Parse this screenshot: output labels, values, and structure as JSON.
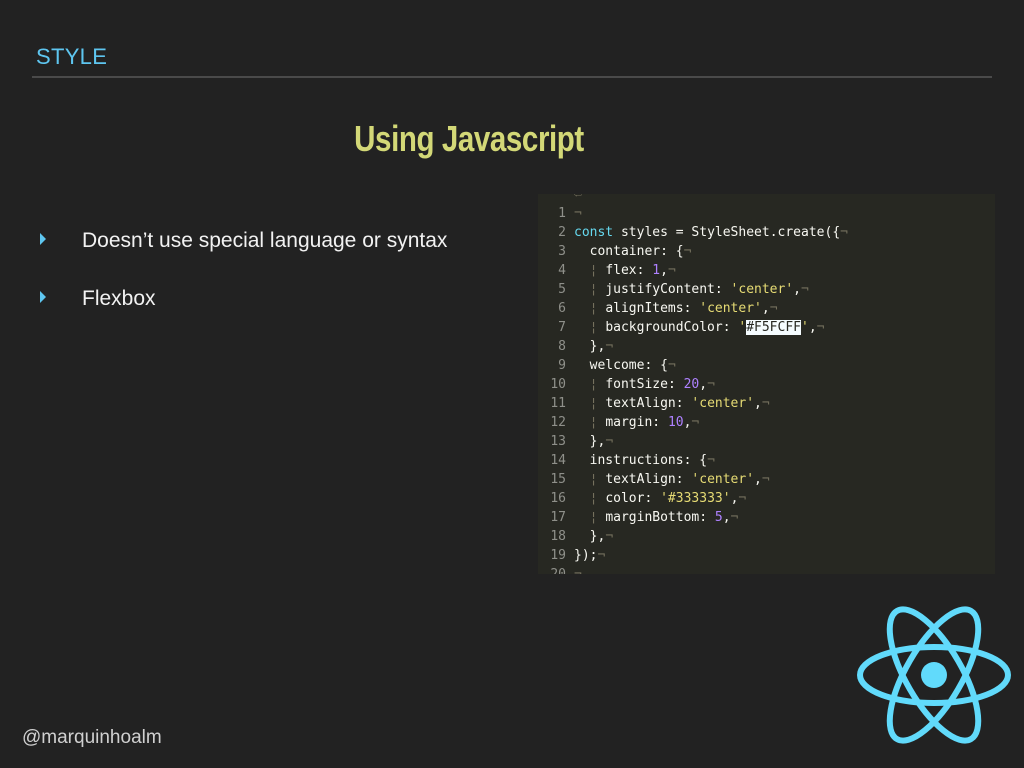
{
  "header": {
    "section_label": "STYLE"
  },
  "slide": {
    "title": "Using Javascript",
    "bullets": [
      {
        "text": "Doesn’t use special language or syntax"
      },
      {
        "text": "Flexbox"
      }
    ]
  },
  "code": {
    "lines": [
      {
        "num": "",
        "text": ""
      },
      {
        "num": "1",
        "text": ""
      },
      {
        "num": "2",
        "text": "const styles = StyleSheet.create({"
      },
      {
        "num": "3",
        "text": "  container: {"
      },
      {
        "num": "4",
        "text": "    flex: 1,"
      },
      {
        "num": "5",
        "text": "    justifyContent: 'center',"
      },
      {
        "num": "6",
        "text": "    alignItems: 'center',"
      },
      {
        "num": "7",
        "text": "    backgroundColor: '#F5FCFF',"
      },
      {
        "num": "8",
        "text": "  },"
      },
      {
        "num": "9",
        "text": "  welcome: {"
      },
      {
        "num": "10",
        "text": "    fontSize: 20,"
      },
      {
        "num": "11",
        "text": "    textAlign: 'center',"
      },
      {
        "num": "12",
        "text": "    margin: 10,"
      },
      {
        "num": "13",
        "text": "  },"
      },
      {
        "num": "14",
        "text": "  instructions: {"
      },
      {
        "num": "15",
        "text": "    textAlign: 'center',"
      },
      {
        "num": "16",
        "text": "    color: '#333333',"
      },
      {
        "num": "17",
        "text": "    marginBottom: 5,"
      },
      {
        "num": "18",
        "text": "  },"
      },
      {
        "num": "19",
        "text": "});"
      },
      {
        "num": "20",
        "text": ""
      }
    ],
    "eol_char": "¬",
    "highlight_color": "#F5FCFF"
  },
  "footer": {
    "handle": "@marquinhoalm"
  },
  "logo": {
    "name": "react-logo",
    "color": "#61dafb"
  },
  "colors": {
    "background": "#222222",
    "accent": "#5ec6f0",
    "title": "#d3d877"
  }
}
